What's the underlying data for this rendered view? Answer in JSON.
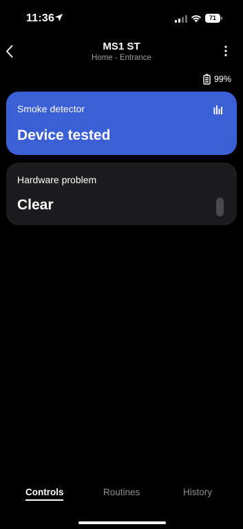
{
  "status_bar": {
    "time": "11:36",
    "battery_percent": "71",
    "icons": [
      "location-arrow-icon",
      "cellular-signal-icon",
      "wifi-icon",
      "battery-icon"
    ]
  },
  "header": {
    "title": "MS1 ST",
    "subtitle": "Home - Entrance",
    "icons": [
      "back-chevron-icon",
      "more-vertical-icon"
    ]
  },
  "device_battery": {
    "value": "99%",
    "icon": "battery-icon"
  },
  "cards": {
    "smoke": {
      "label": "Smoke detector",
      "value": "Device tested",
      "color": "#3b5fd4",
      "icon": "bar-chart-icon"
    },
    "hardware": {
      "label": "Hardware problem",
      "value": "Clear",
      "color": "#1c1c1e"
    }
  },
  "tabs": {
    "items": [
      {
        "label": "Controls",
        "active": true
      },
      {
        "label": "Routines",
        "active": false
      },
      {
        "label": "History",
        "active": false
      }
    ]
  },
  "colors": {
    "background": "#000000",
    "accent": "#3b5fd4",
    "muted_text": "#8e8e8e"
  }
}
